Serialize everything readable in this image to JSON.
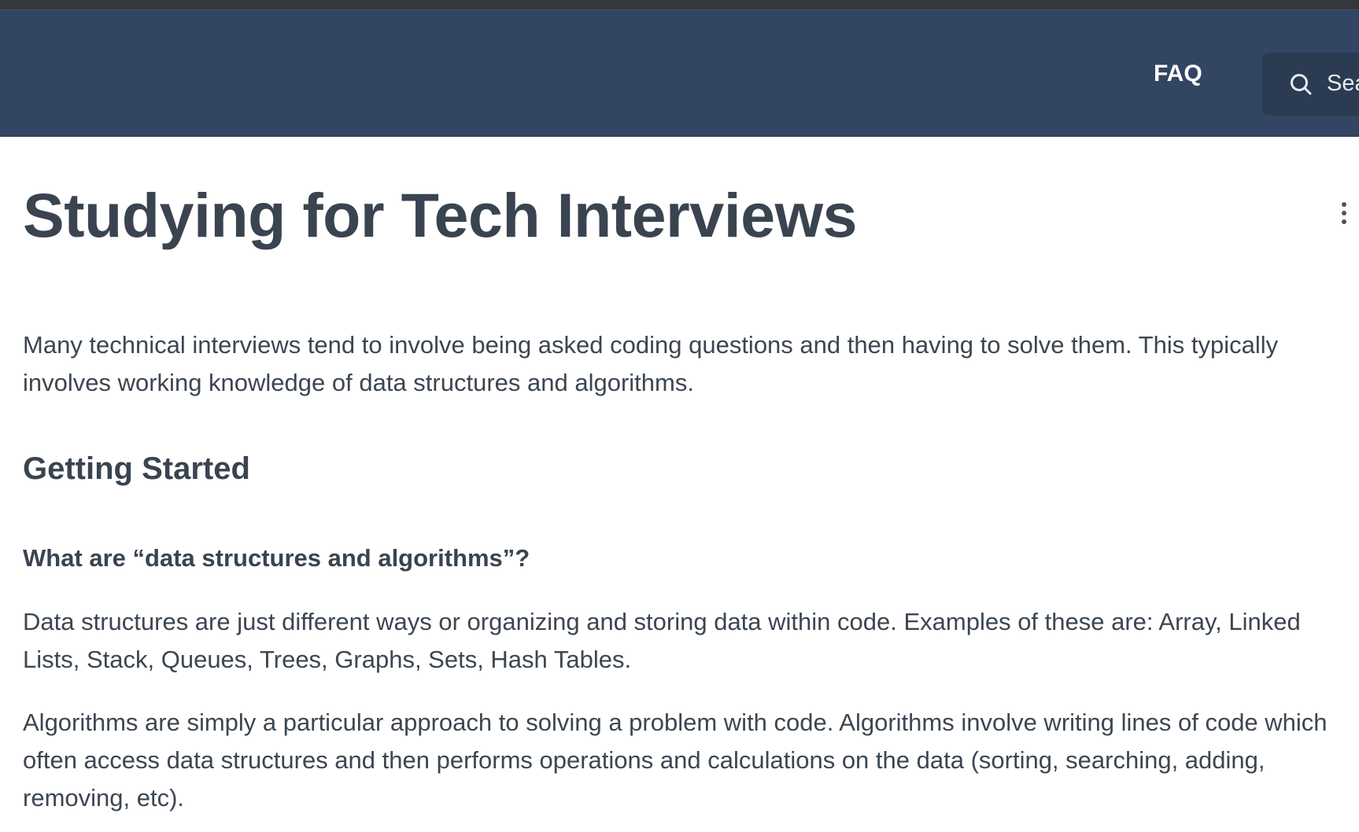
{
  "header": {
    "nav_faq": "FAQ",
    "search_placeholder": "Sea",
    "background_color": "#324562"
  },
  "article": {
    "title": "Studying for Tech Interviews",
    "intro": "Many technical interviews tend to involve being asked coding questions and then having to solve them. This typically involves working knowledge of data structures and algorithms.",
    "section_heading": "Getting Started",
    "question_heading": "What are “data structures and algorithms”?",
    "paragraph_data_structures": "Data structures are just different ways or organizing and storing data within code. Examples of these are: Array, Linked Lists, Stack, Queues, Trees, Graphs, Sets, Hash Tables.",
    "paragraph_algorithms": "Algorithms are simply a particular approach to solving a problem with code. Algorithms involve writing lines of code which often access data structures and then performs operations and calculations on the data (sorting, searching, adding, removing, etc).",
    "text_color": "#3c4651"
  },
  "icons": {
    "search": "search-icon",
    "more": "more-vertical-icon"
  }
}
